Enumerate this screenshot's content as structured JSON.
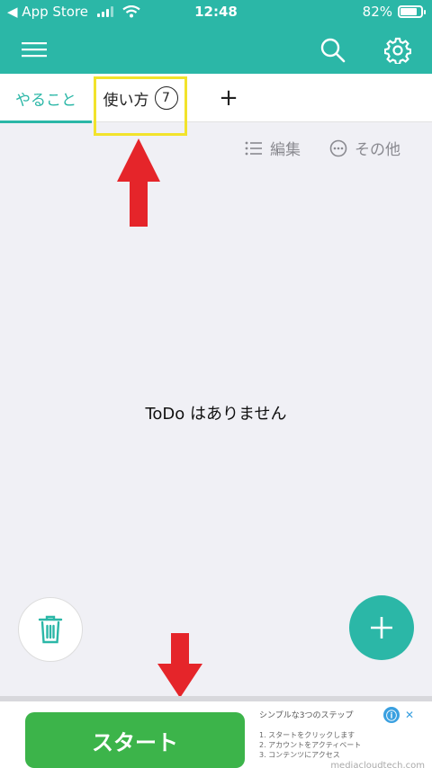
{
  "status_bar": {
    "back_label": "◀ App Store",
    "time": "12:48",
    "battery": "82%",
    "battery_level": 0.82
  },
  "app_bar": {
    "menu_icon": "hamburger-menu-icon",
    "search_icon": "search-icon",
    "settings_icon": "gear-icon"
  },
  "tabs": [
    {
      "label": "やること",
      "active": true
    },
    {
      "label": "使い方",
      "count": "7",
      "active": false
    }
  ],
  "add_tab_label": "+",
  "toolbar": {
    "edit_label": "編集",
    "more_label": "その他"
  },
  "empty_message": "ToDo はありません",
  "ad": {
    "button_label": "スタート",
    "title": "シンプルな3つのステップ",
    "steps": [
      "1. スタートをクリックします",
      "2. アカウントをアクティベート",
      "3. コンテンツにアクセス"
    ],
    "info_icon": "ⓘ",
    "close_icon": "✕",
    "domain": "mediacloudtech.com"
  },
  "colors": {
    "accent": "#2bb7a7",
    "annotation_red": "#e5252a",
    "highlight_yellow": "#f2e32b",
    "ad_green": "#3cb44a"
  }
}
